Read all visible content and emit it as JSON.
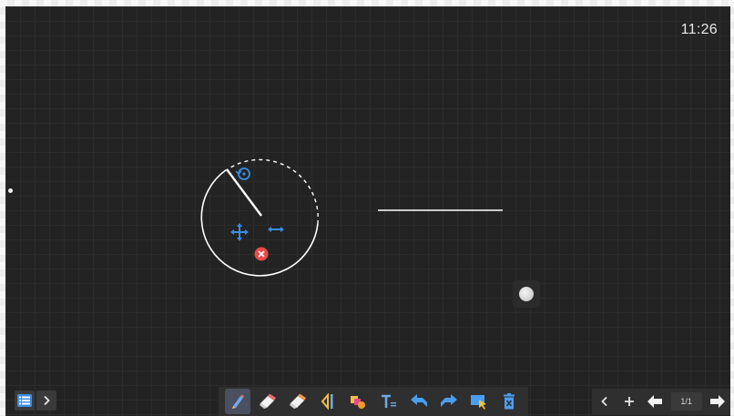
{
  "status": {
    "time": "11:26"
  },
  "canvas": {
    "stroke_color": "#ffffff",
    "handle_color": "#3a8ee6",
    "delete_color": "#e84a4a",
    "background": "#232323"
  },
  "toolbar": {
    "left": [
      {
        "name": "menu-icon",
        "label": ""
      },
      {
        "name": "chevron-right-icon",
        "label": ""
      }
    ],
    "tools": [
      {
        "name": "pen-icon",
        "active": true
      },
      {
        "name": "eraser-icon"
      },
      {
        "name": "eraser-alt-icon"
      },
      {
        "name": "compass-ruler-icon"
      },
      {
        "name": "shapes-icon"
      },
      {
        "name": "text-icon"
      },
      {
        "name": "undo-icon"
      },
      {
        "name": "redo-icon"
      },
      {
        "name": "select-icon"
      },
      {
        "name": "trash-icon"
      }
    ]
  },
  "pager": {
    "current": "1/1",
    "buttons": [
      "chevron-left-icon",
      "plus-icon",
      "prev-page-icon",
      "next-page-icon"
    ]
  }
}
